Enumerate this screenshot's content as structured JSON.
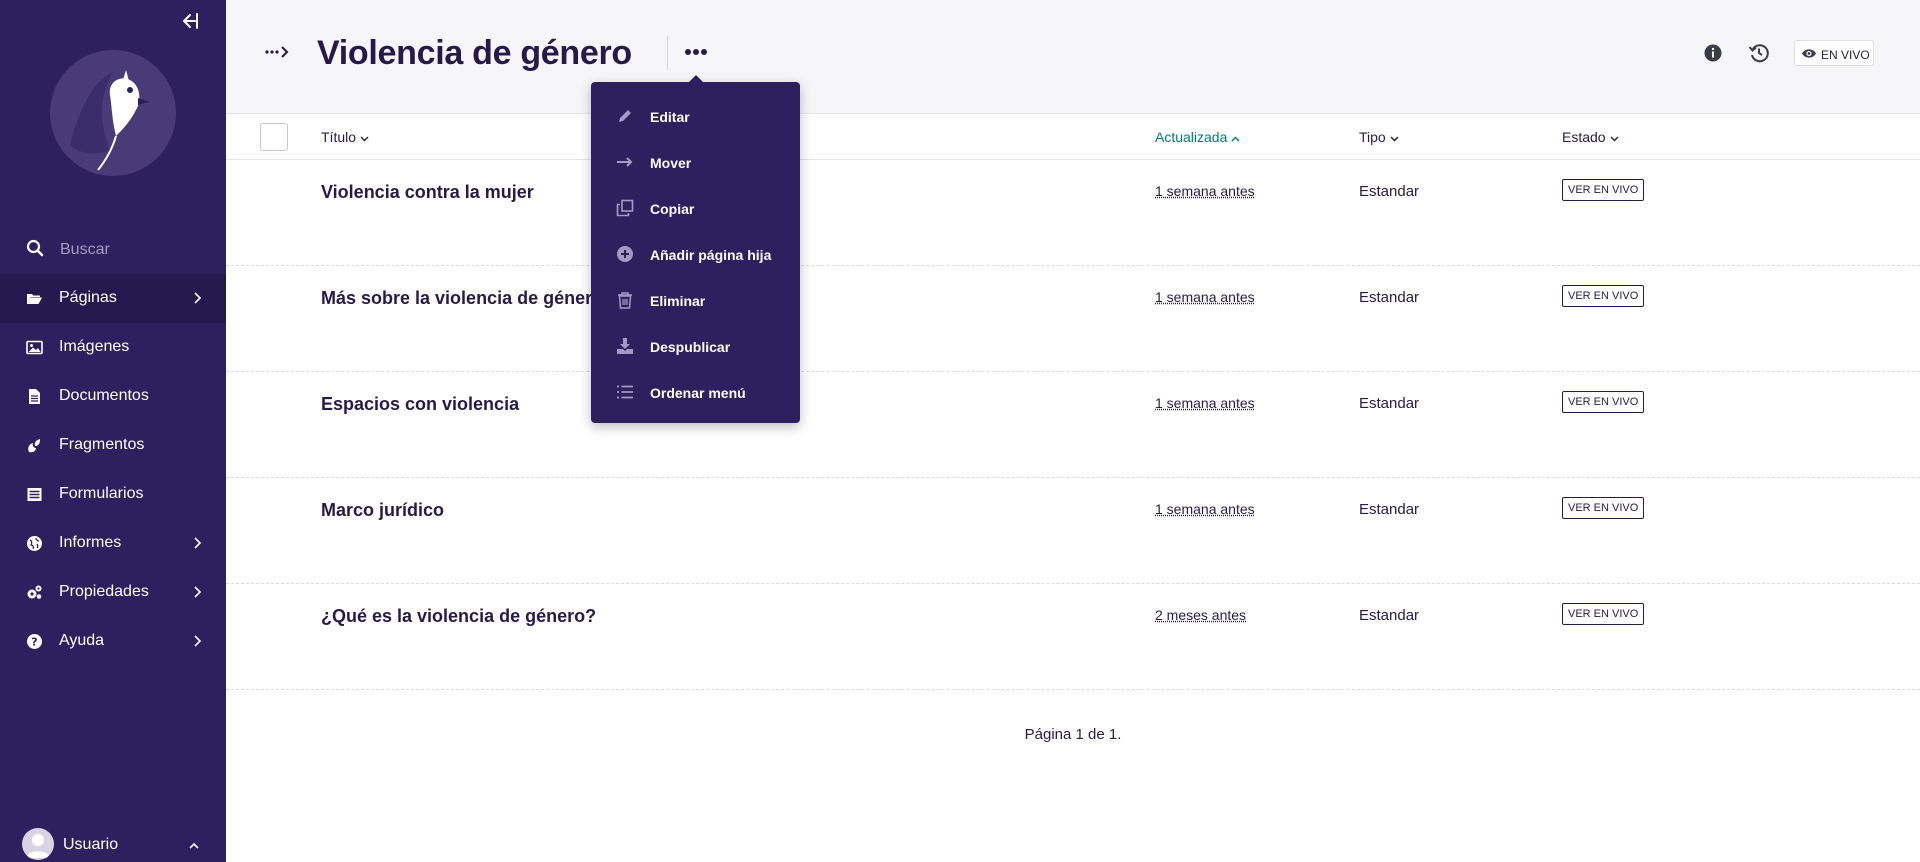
{
  "sidebar": {
    "search_placeholder": "Buscar",
    "items": [
      {
        "label": "Páginas",
        "icon": "folder-open-icon",
        "has_children": true,
        "active": true
      },
      {
        "label": "Imágenes",
        "icon": "image-icon",
        "has_children": false
      },
      {
        "label": "Documentos",
        "icon": "document-icon",
        "has_children": false
      },
      {
        "label": "Fragmentos",
        "icon": "snippet-icon",
        "has_children": false
      },
      {
        "label": "Formularios",
        "icon": "form-icon",
        "has_children": false
      },
      {
        "label": "Informes",
        "icon": "globe-icon",
        "has_children": true
      },
      {
        "label": "Propiedades",
        "icon": "cogs-icon",
        "has_children": true
      },
      {
        "label": "Ayuda",
        "icon": "help-icon",
        "has_children": true
      }
    ],
    "user": {
      "name": "Usuario"
    }
  },
  "header": {
    "title": "Violencia de género",
    "live_label": "EN VIVO"
  },
  "dropdown": {
    "items": [
      {
        "label": "Editar",
        "icon": "pencil-icon"
      },
      {
        "label": "Mover",
        "icon": "arrow-right-icon"
      },
      {
        "label": "Copiar",
        "icon": "copy-icon"
      },
      {
        "label": "Añadir página hija",
        "icon": "plus-circle-icon"
      },
      {
        "label": "Eliminar",
        "icon": "trash-icon"
      },
      {
        "label": "Despublicar",
        "icon": "download-icon"
      },
      {
        "label": "Ordenar menú",
        "icon": "list-icon"
      }
    ]
  },
  "table": {
    "columns": {
      "title": "Título",
      "updated": "Actualizada",
      "type": "Tipo",
      "status": "Estado"
    },
    "rows": [
      {
        "title": "Violencia contra la mujer",
        "updated": "1 semana antes",
        "type": "Estandar",
        "status": "VER EN VIVO"
      },
      {
        "title": "Más sobre la violencia de género",
        "updated": "1 semana antes",
        "type": "Estandar",
        "status": "VER EN VIVO"
      },
      {
        "title": "Espacios con violencia",
        "updated": "1 semana antes",
        "type": "Estandar",
        "status": "VER EN VIVO"
      },
      {
        "title": "Marco jurídico",
        "updated": "1 semana antes",
        "type": "Estandar",
        "status": "VER EN VIVO"
      },
      {
        "title": "¿Qué es la violencia de género?",
        "updated": "2 meses antes",
        "type": "Estandar",
        "status": "VER EN VIVO"
      }
    ]
  },
  "pagination": "Página 1 de 1.",
  "colors": {
    "sidebar_bg": "#2e1f5e",
    "text_primary": "#261a4b",
    "accent_sorted": "#007d7e"
  }
}
